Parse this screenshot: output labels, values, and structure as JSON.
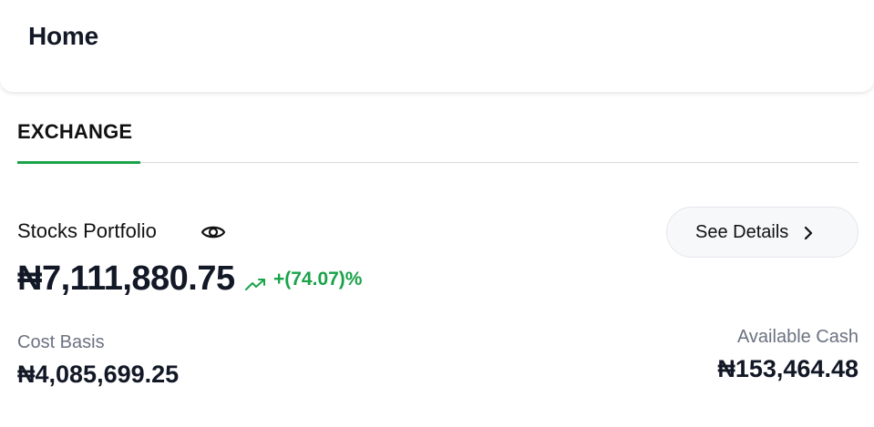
{
  "header": {
    "title": "Home"
  },
  "tabs": [
    {
      "label": "EXCHANGE",
      "active": true
    }
  ],
  "portfolio": {
    "label": "Stocks Portfolio",
    "visibility_icon": "eye-icon",
    "balance": "₦7,111,880.75",
    "trend_icon": "trending-up-icon",
    "change": "+(74.07)%",
    "see_details_label": "See Details",
    "see_details_icon": "chevron-right-icon"
  },
  "cost_basis": {
    "label": "Cost Basis",
    "value": "₦4,085,699.25"
  },
  "available_cash": {
    "label": "Available Cash",
    "value": "₦153,464.48"
  },
  "colors": {
    "accent_green": "#1aa34a",
    "text_dark": "#121826",
    "text_muted": "#6b7280"
  }
}
